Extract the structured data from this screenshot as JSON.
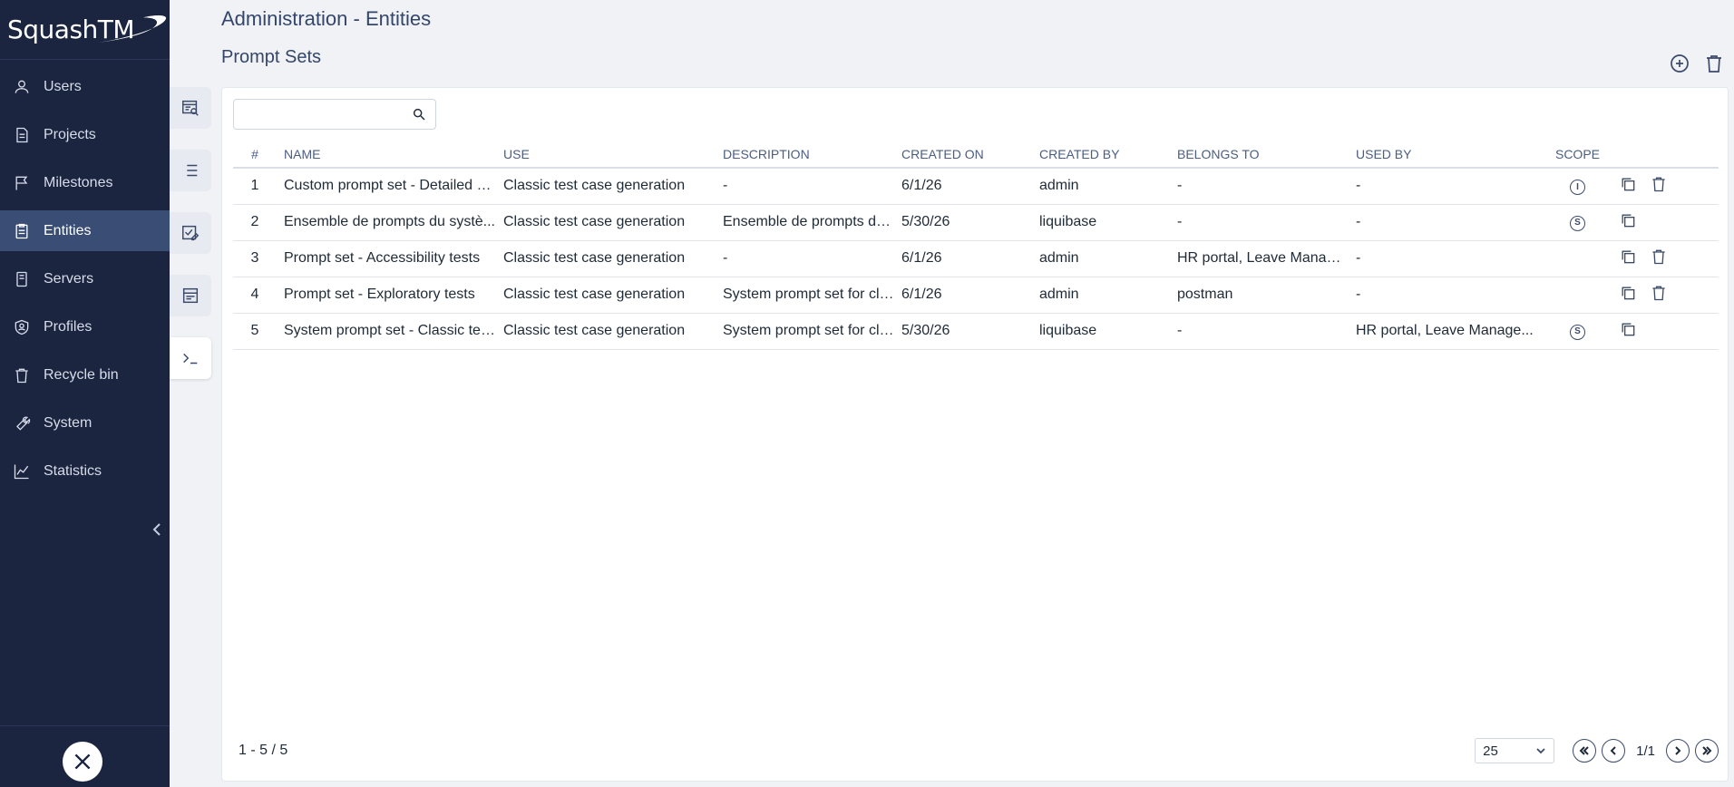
{
  "app": {
    "name": "SquashTM"
  },
  "colors": {
    "sidebar_bg": "#1b2540",
    "sidebar_active": "#3a4d74",
    "accent": "#34466b"
  },
  "sidebar": {
    "items": [
      {
        "label": "Users",
        "icon": "user-icon",
        "active": false
      },
      {
        "label": "Projects",
        "icon": "document-icon",
        "active": false
      },
      {
        "label": "Milestones",
        "icon": "flag-icon",
        "active": false
      },
      {
        "label": "Entities",
        "icon": "clipboard-icon",
        "active": true
      },
      {
        "label": "Servers",
        "icon": "server-icon",
        "active": false
      },
      {
        "label": "Profiles",
        "icon": "shield-user-icon",
        "active": false
      },
      {
        "label": "Recycle bin",
        "icon": "trash-icon",
        "active": false
      },
      {
        "label": "System",
        "icon": "wrench-icon",
        "active": false
      },
      {
        "label": "Statistics",
        "icon": "chart-line-icon",
        "active": false
      }
    ]
  },
  "header": {
    "title": "Administration - Entities",
    "section": "Prompt Sets"
  },
  "search": {
    "placeholder": "",
    "value": ""
  },
  "table": {
    "columns": [
      "#",
      "NAME",
      "USE",
      "DESCRIPTION",
      "CREATED ON",
      "CREATED BY",
      "BELONGS TO",
      "USED BY",
      "SCOPE"
    ],
    "rows": [
      {
        "num": "1",
        "name": "Custom prompt set - Detailed g...",
        "use": "Classic test case generation",
        "description": "-",
        "created_on": "6/1/26",
        "created_by": "admin",
        "belongs_to": "-",
        "used_by": "-",
        "scope": "I",
        "deletable": true
      },
      {
        "num": "2",
        "name": "Ensemble de prompts du systè...",
        "use": "Classic test case generation",
        "description": "Ensemble de prompts du ...",
        "created_on": "5/30/26",
        "created_by": "liquibase",
        "belongs_to": "-",
        "used_by": "-",
        "scope": "S",
        "deletable": false
      },
      {
        "num": "3",
        "name": "Prompt set - Accessibility tests",
        "use": "Classic test case generation",
        "description": "-",
        "created_on": "6/1/26",
        "created_by": "admin",
        "belongs_to": "HR portal, Leave Manage...",
        "used_by": "-",
        "scope": "",
        "deletable": true
      },
      {
        "num": "4",
        "name": "Prompt set - Exploratory tests",
        "use": "Classic test case generation",
        "description": "System prompt set for cla...",
        "created_on": "6/1/26",
        "created_by": "admin",
        "belongs_to": "postman",
        "used_by": "-",
        "scope": "",
        "deletable": true
      },
      {
        "num": "5",
        "name": "System prompt set - Classic test...",
        "use": "Classic test case generation",
        "description": "System prompt set for cla...",
        "created_on": "5/30/26",
        "created_by": "liquibase",
        "belongs_to": "-",
        "used_by": "HR portal, Leave Manage...",
        "scope": "S",
        "deletable": false
      }
    ]
  },
  "footer": {
    "count": "1 - 5 / 5",
    "page_size": "25",
    "page_label": "1/1"
  }
}
